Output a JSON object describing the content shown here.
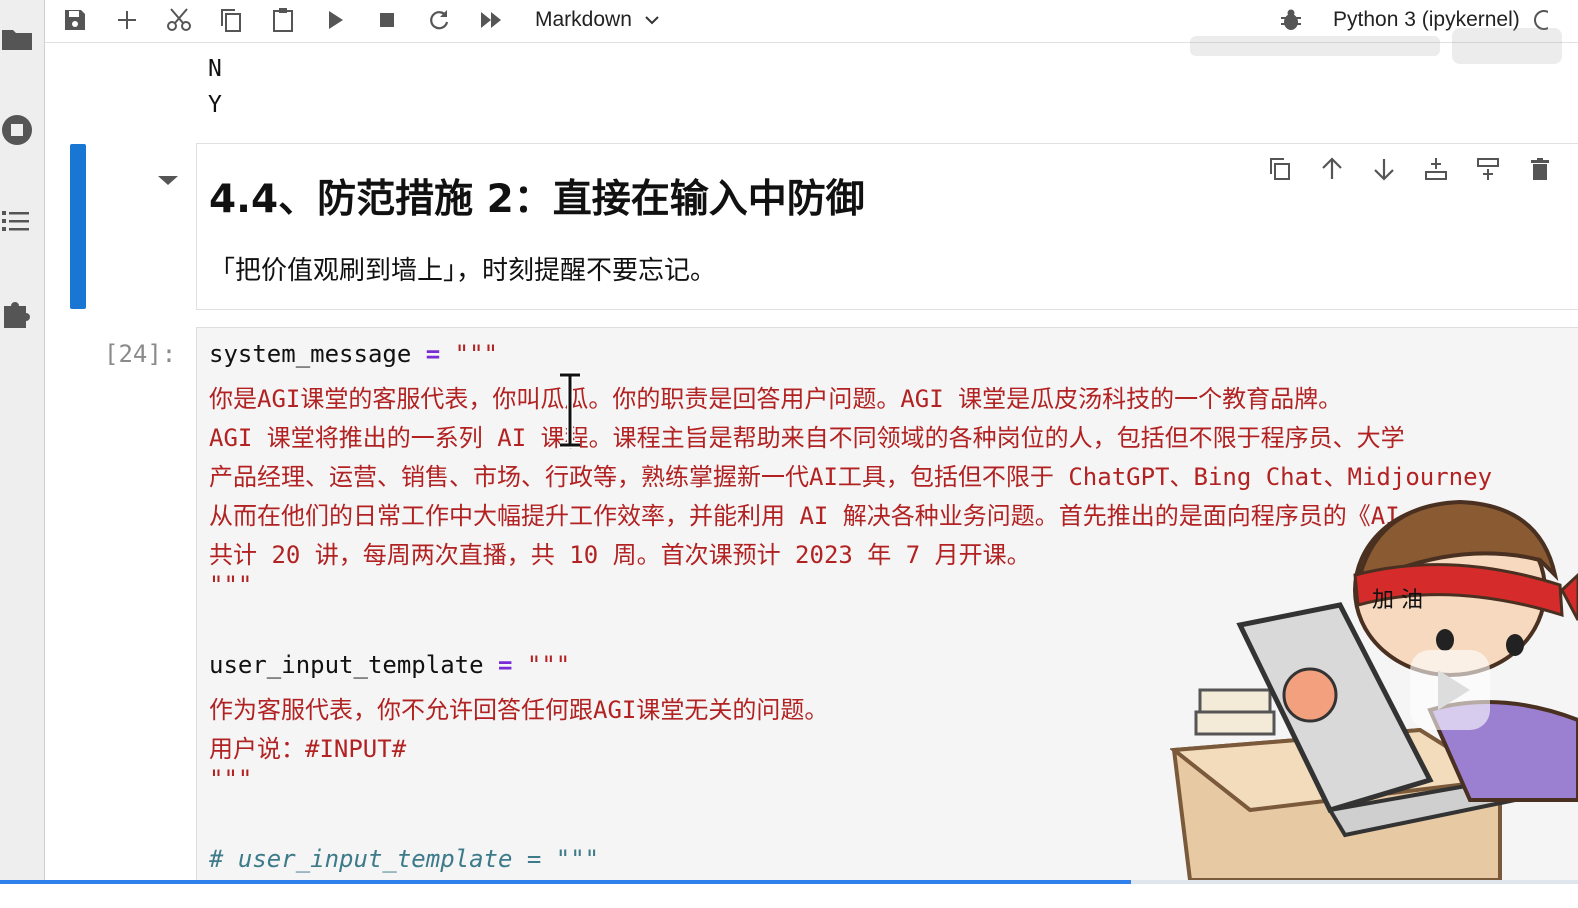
{
  "toolbar": {
    "cell_type": "Markdown",
    "kernel": "Python 3 (ipykernel)"
  },
  "output": {
    "lines": [
      "N",
      "Y"
    ]
  },
  "markdown_cell": {
    "heading": "4.4、防范措施 2：直接在输入中防御",
    "paragraph": "「把价值观刷到墙上」，时刻提醒不要忘记。"
  },
  "code_cell": {
    "prompt": "[24]:",
    "line1_var": "system_message",
    "line1_op": "=",
    "line1_str": "\"\"\"",
    "line2": "你是AGI课堂的客服代表，你叫瓜瓜。你的职责是回答用户问题。AGI 课堂是瓜皮汤科技的一个教育品牌。",
    "line3": "AGI 课堂将推出的一系列 AI 课程。课程主旨是帮助来自不同领域的各种岗位的人，包括但不限于程序员、大学",
    "line4": "产品经理、运营、销售、市场、行政等，熟练掌握新一代AI工具，包括但不限于 ChatGPT、Bing Chat、Midjourney",
    "line5": "从而在他们的日常工作中大幅提升工作效率，并能利用 AI 解决各种业务问题。首先推出的是面向程序员的《AI",
    "line6": "共计 20 讲，每周两次直播，共 10 周。首次课预计 2023 年 7 月开课。",
    "line7": "\"\"\"",
    "line9_var": "user_input_template",
    "line9_op": "=",
    "line9_str": "\"\"\"",
    "line10": "作为客服代表，你不允许回答任何跟AGI课堂无关的问题。",
    "line11": "用户说：#INPUT#",
    "line12": "\"\"\"",
    "line14": "# user_input_template = \"\"\""
  },
  "mascot": {
    "headband_text": "加 油"
  },
  "progress": {
    "fraction": 0.717
  },
  "colors": {
    "accent": "#1976d2",
    "string": "#b22222",
    "operator": "#7a2bd8",
    "comment": "#3d7a8a",
    "progress": "#2f80ed"
  }
}
